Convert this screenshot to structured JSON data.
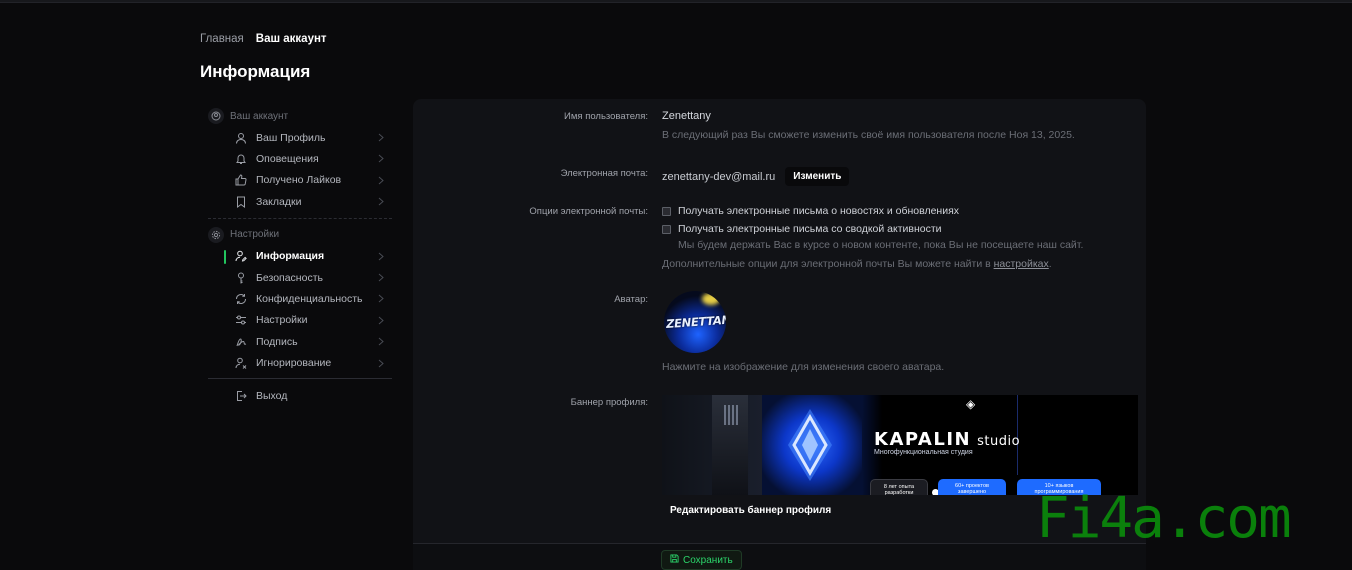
{
  "breadcrumb": {
    "home": "Главная",
    "current": "Ваш аккаунт"
  },
  "page_title": "Информация",
  "sidebar": {
    "account_header": "Ваш аккаунт",
    "account_items": [
      {
        "label": "Ваш Профиль",
        "icon": "user-icon"
      },
      {
        "label": "Оповещения",
        "icon": "bell-icon"
      },
      {
        "label": "Получено Лайков",
        "icon": "thumbs-up-icon"
      },
      {
        "label": "Закладки",
        "icon": "bookmark-icon"
      }
    ],
    "settings_header": "Настройки",
    "settings_items": [
      {
        "label": "Информация",
        "icon": "user-edit-icon",
        "active": true
      },
      {
        "label": "Безопасность",
        "icon": "key-icon"
      },
      {
        "label": "Конфиденциальность",
        "icon": "privacy-icon"
      },
      {
        "label": "Настройки",
        "icon": "sliders-icon"
      },
      {
        "label": "Подпись",
        "icon": "signature-icon"
      },
      {
        "label": "Игнорирование",
        "icon": "user-block-icon"
      }
    ],
    "logout": "Выход"
  },
  "form": {
    "username_label": "Имя пользователя:",
    "username_value": "Zenettany",
    "username_hint": "В следующий раз Вы сможете изменить своё имя пользователя после Ноя 13, 2025.",
    "email_label": "Электронная почта:",
    "email_value": "zenettany-dev@mail.ru",
    "email_change_button": "Изменить",
    "email_options_label": "Опции электронной почты:",
    "option_news": "Получать электронные письма о новостях и обновлениях",
    "option_digest": "Получать электронные письма со сводкой активности",
    "option_digest_hint": "Мы будем держать Вас в курсе о новом контенте, пока Вы не посещаете наш сайт.",
    "more_options_prefix": "Дополнительные опции для электронной почты Вы можете найти в ",
    "more_options_link": "настройках",
    "more_options_suffix": ".",
    "avatar_label": "Аватар:",
    "avatar_text": "ZENETTANY",
    "avatar_hint": "Нажмите на изображение для изменения своего аватара.",
    "banner_label": "Баннер профиля:",
    "banner_edit_button": "Редактировать баннер профиля",
    "save_button": "Сохранить"
  },
  "banner": {
    "title": "KAPALIN",
    "title_suffix": "studio",
    "subtitle": "Многофункциональная студия",
    "stat1": "8 лет опыта разработки",
    "stat2": "60+ проектов завершено",
    "stat3": "10+ языков программирования"
  },
  "watermark": "Fi4a.com",
  "colors": {
    "accent_green": "#22c55e",
    "background": "#0a0a0c",
    "panel": "#111216"
  }
}
